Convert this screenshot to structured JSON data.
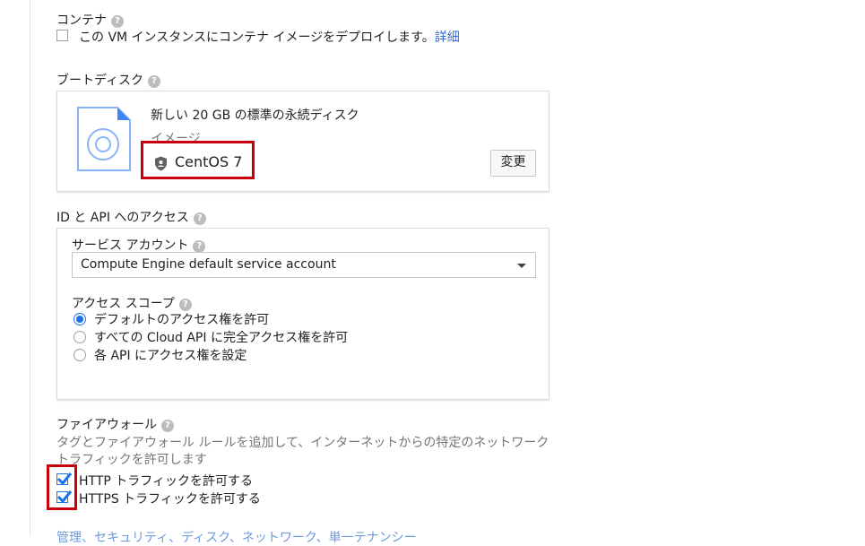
{
  "container": {
    "heading": "コンテナ",
    "checkbox_label": "この VM インスタンスにコンテナ イメージをデプロイします。",
    "details_link": "詳細",
    "checked": false
  },
  "boot_disk": {
    "heading": "ブートディスク",
    "description": "新しい 20 GB の標準の永続ディスク",
    "image_label": "イメージ",
    "image_value": "CentOS 7",
    "change_button": "変更"
  },
  "identity": {
    "heading": "ID と API へのアクセス",
    "service_account_label": "サービス アカウント",
    "service_account_value": "Compute Engine default service account",
    "access_scope_label": "アクセス スコープ",
    "scopes": [
      {
        "label": "デフォルトのアクセス権を許可",
        "selected": true
      },
      {
        "label": "すべての Cloud API に完全アクセス権を許可",
        "selected": false
      },
      {
        "label": "各 API にアクセス権を設定",
        "selected": false
      }
    ]
  },
  "firewall": {
    "heading": "ファイアウォール",
    "description_line1": "タグとファイアウォール ルールを追加して、インターネットからの特定のネットワーク",
    "description_line2": "トラフィックを許可します",
    "http_label": "HTTP トラフィックを許可する",
    "https_label": "HTTPS トラフィックを許可する",
    "http_checked": true,
    "https_checked": true
  },
  "footer_link": "管理、セキュリティ、ディスク、ネットワーク、単一テナンシー",
  "icons": {
    "help": "help-icon",
    "shield": "shield-icon",
    "disk": "disk-image-icon",
    "check": "check-icon",
    "dropdown": "chevron-down-icon"
  },
  "colors": {
    "accent": "#1a73e8",
    "link": "#3367d6",
    "highlight": "#c8000b"
  }
}
